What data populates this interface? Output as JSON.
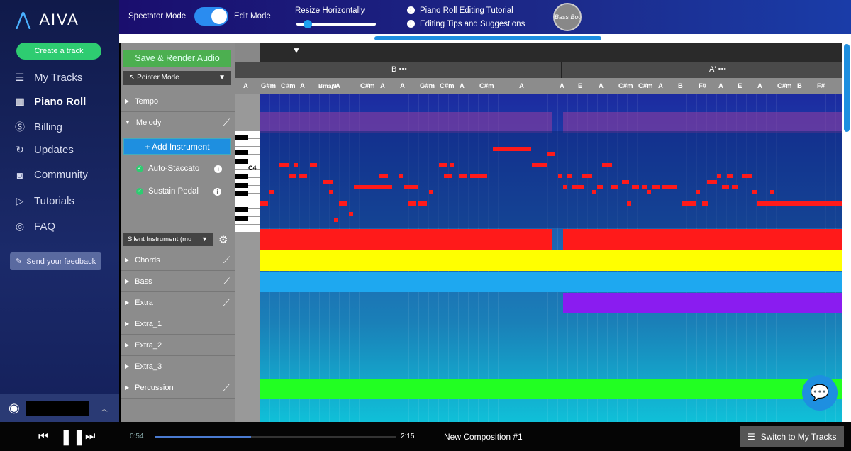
{
  "sidebar": {
    "brand": "AIVA",
    "create": "Create a track",
    "items": [
      {
        "label": "My Tracks",
        "icon": "list-icon"
      },
      {
        "label": "Piano Roll",
        "icon": "piano-icon",
        "active": true
      },
      {
        "label": "Billing",
        "icon": "dollar-icon"
      },
      {
        "label": "Updates",
        "icon": "refresh-icon"
      },
      {
        "label": "Community",
        "icon": "discord-icon"
      },
      {
        "label": "Tutorials",
        "icon": "youtube-icon"
      },
      {
        "label": "FAQ",
        "icon": "lifebuoy-icon"
      }
    ],
    "feedback": "Send your feedback"
  },
  "topbar": {
    "spectator": "Spectator Mode",
    "edit": "Edit Mode",
    "edit_mode_on": true,
    "resize": "Resize Horizontally",
    "resize_value": 0.12,
    "tutorial": "Piano Roll Editing Tutorial",
    "tips": "Editing Tips and Suggestions",
    "avatar_text": "Bass Boost"
  },
  "panel": {
    "save": "Save & Render Audio",
    "pointer": "Pointer Mode",
    "add_instrument": "+ Add Instrument",
    "auto_staccato": "Auto-Staccato",
    "sustain": "Sustain Pedal",
    "instrument": "Silent Instrument (mu",
    "tracks": [
      "Tempo",
      "Melody",
      "Chords",
      "Bass",
      "Extra",
      "Extra_1",
      "Extra_2",
      "Extra_3",
      "Percussion"
    ]
  },
  "sections": [
    "B",
    "A'"
  ],
  "chords": [
    "A",
    "G#m",
    "C#m",
    "A",
    "Bmaj9",
    "A",
    "C#m",
    "A",
    "A",
    "G#m",
    "C#m",
    "A",
    "C#m",
    "A",
    "A",
    "E",
    "A",
    "C#m",
    "C#m",
    "A",
    "B",
    "F#",
    "A",
    "E",
    "A",
    "C#m",
    "B",
    "F#"
  ],
  "key_label": "C4",
  "colors": {
    "melody": "#ff1a1a",
    "chords": "#ffff00",
    "bass": "#1ea8f0",
    "extra": "#8a1cf0",
    "percussion": "#22ff22"
  },
  "player": {
    "elapsed": "0:54",
    "duration": "2:15",
    "progress": 0.4,
    "title": "New Composition #1",
    "switch": "Switch to My Tracks"
  }
}
